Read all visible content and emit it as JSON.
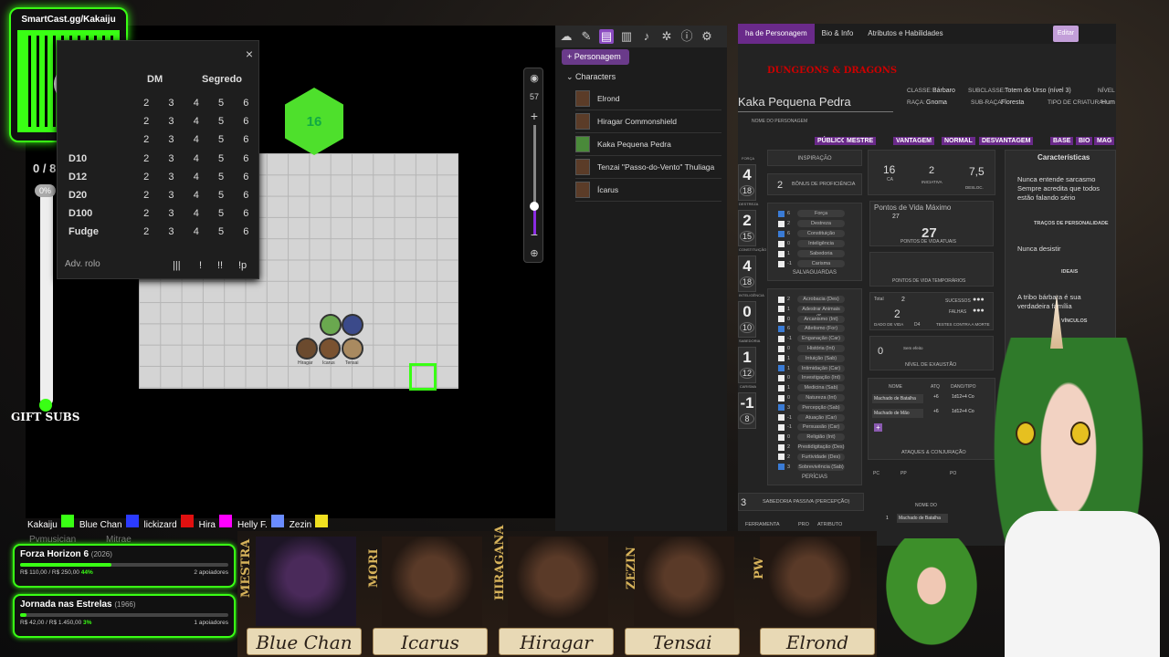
{
  "qr": {
    "title": "SmartCast.gg/Kakaiju"
  },
  "gift": {
    "count": "0 / 8",
    "pct": "0%",
    "label": "GIFT SUBS"
  },
  "dice": {
    "header_dm": "DM",
    "header_secret": "Segredo",
    "close": "×",
    "rows": [
      {
        "name": "",
        "vals": [
          "2",
          "3",
          "4",
          "5",
          "6"
        ]
      },
      {
        "name": "",
        "vals": [
          "2",
          "3",
          "4",
          "5",
          "6"
        ]
      },
      {
        "name": "",
        "vals": [
          "2",
          "3",
          "4",
          "5",
          "6"
        ]
      },
      {
        "name": "D10",
        "vals": [
          "2",
          "3",
          "4",
          "5",
          "6"
        ]
      },
      {
        "name": "D12",
        "vals": [
          "2",
          "3",
          "4",
          "5",
          "6"
        ]
      },
      {
        "name": "D20",
        "vals": [
          "2",
          "3",
          "4",
          "5",
          "6"
        ]
      },
      {
        "name": "D100",
        "vals": [
          "2",
          "3",
          "4",
          "5",
          "6"
        ]
      },
      {
        "name": "Fudge",
        "vals": [
          "2",
          "3",
          "4",
          "5",
          "6"
        ]
      }
    ],
    "adv": "Adv. rolo",
    "btn1": "|||",
    "btn2": "!",
    "btn3": "!!",
    "btn4": "!p"
  },
  "map": {
    "d20": "16",
    "tokens": [
      "Hiragar",
      "Icarus",
      "Tensai"
    ]
  },
  "zoom": {
    "eye": "◉",
    "value": "57",
    "plus": "+",
    "minus": "−",
    "target": "⊕"
  },
  "sidebar": {
    "add_label": "+ Personagem",
    "characters_label": "Characters",
    "characters": [
      "Elrond",
      "Hiragar Commonshield",
      "Kaka Pequena Pedra",
      "Tenzai \"Passo-do-Vento\" Thuliaga",
      "Ícarus"
    ]
  },
  "sheet": {
    "tabs": [
      "ha de Personagem",
      "Bio & Info",
      "Atributos e Habilidades"
    ],
    "edit": "Editar",
    "logo": "DUNGEONS & DRAGONS",
    "name": "Kaka Pequena Pedra",
    "name_label": "NOME DO PERSONAGEM",
    "class_l": "CLASSE:",
    "class_v": "Bárbaro",
    "subclass_l": "SUBCLASSE:",
    "subclass_v": "Totem do Urso (nível 3)",
    "level_l": "NÍVEL",
    "race_l": "RAÇA:",
    "race_v": "Gnoma",
    "subrace_l": "SUB-RAÇA:",
    "subrace_v": "Floresta",
    "type_l": "TIPO DE CRIATURA:",
    "type_v": "Hum",
    "pills": [
      "PÚBLICO",
      "MESTRE",
      "VANTAGEM",
      "NORMAL",
      "DESVANTAGEM",
      "BASE",
      "BIO",
      "MAG"
    ],
    "insp": "INSPIRAÇÃO",
    "prof_v": "2",
    "prof_l": "BÔNUS DE PROFICIÊNCIA",
    "stats": [
      {
        "s": "FORÇA",
        "v": "4",
        "m": "18"
      },
      {
        "s": "DESTREZA",
        "v": "2",
        "m": "15"
      },
      {
        "s": "CONSTITUIÇÃO",
        "v": "4",
        "m": "18"
      },
      {
        "s": "INTELIGÊNCIA",
        "v": "0",
        "m": "10"
      },
      {
        "s": "SABEDORIA",
        "v": "1",
        "m": "12"
      },
      {
        "s": "CARISMA",
        "v": "-1",
        "m": "8"
      }
    ],
    "saves": [
      {
        "v": "6",
        "n": "Força",
        "c": true
      },
      {
        "v": "2",
        "n": "Destreza",
        "c": false
      },
      {
        "v": "6",
        "n": "Constituição",
        "c": true
      },
      {
        "v": "0",
        "n": "Inteligência",
        "c": false
      },
      {
        "v": "1",
        "n": "Sabedoria",
        "c": false
      },
      {
        "v": "-1",
        "n": "Carisma",
        "c": false
      }
    ],
    "saves_l": "SALVAGUARDAS",
    "skills": [
      {
        "v": "2",
        "n": "Acrobacia (Des)",
        "c": false
      },
      {
        "v": "1",
        "n": "Adestrar Animais (S...",
        "c": false
      },
      {
        "v": "0",
        "n": "Arcanismo (Int)",
        "c": false
      },
      {
        "v": "6",
        "n": "Atletismo (For)",
        "c": true
      },
      {
        "v": "-1",
        "n": "Enganação (Car)",
        "c": false
      },
      {
        "v": "0",
        "n": "História (Int)",
        "c": false
      },
      {
        "v": "1",
        "n": "Intuição (Sab)",
        "c": false
      },
      {
        "v": "1",
        "n": "Intimidação (Car)",
        "c": true
      },
      {
        "v": "0",
        "n": "Investigação (Int)",
        "c": false
      },
      {
        "v": "1",
        "n": "Medicina (Sab)",
        "c": false
      },
      {
        "v": "0",
        "n": "Natureza (Int)",
        "c": false
      },
      {
        "v": "3",
        "n": "Percepção (Sab)",
        "c": true
      },
      {
        "v": "-1",
        "n": "Atuação (Car)",
        "c": false
      },
      {
        "v": "-1",
        "n": "Persuasão (Car)",
        "c": false
      },
      {
        "v": "0",
        "n": "Religião (Int)",
        "c": false
      },
      {
        "v": "2",
        "n": "Prestidigitação (Des)",
        "c": false
      },
      {
        "v": "2",
        "n": "Furtividade (Des)",
        "c": false
      },
      {
        "v": "3",
        "n": "Sobrevivência (Sab)",
        "c": true
      }
    ],
    "skills_l": "PERÍCIAS",
    "passive_v": "3",
    "passive_l": "SABEDORIA PASSIVA (PERCEPÇÃO)",
    "ca_v": "16",
    "ca_l": "CA",
    "init_v": "2",
    "init_l": "INICIATIVA",
    "speed_v": "7,5",
    "speed_l": "DESLOC.",
    "hpmax_l": "Pontos de Vida Máximo",
    "hpmax_v": "27",
    "hp_v": "27",
    "hp_l": "PONTOS DE VIDA ATUAIS",
    "thp_l": "PONTOS DE VIDA TEMPORÁRIOS",
    "hd_total_l": "Total",
    "hd_total_v": "2",
    "hd_v": "2",
    "hd_die": "D4",
    "hd_l": "DADO DE VIDA",
    "succ_l": "SUCESSOS",
    "fail_l": "FALHAS",
    "death_l": "TESTES CONTRA A MORTE",
    "exh_v": "0",
    "exh_note": "Sem efeito",
    "exh_l": "NÍVEL DE EXAUSTÃO",
    "atk_h": [
      "NOME",
      "ATQ",
      "DANO/TIPO"
    ],
    "attacks": [
      {
        "n": "Machado de Batalha",
        "a": "+6",
        "d": "1d12+4 Co"
      },
      {
        "n": "Machado de Mão",
        "a": "+6",
        "d": "1d12+4 Co"
      }
    ],
    "atk_l": "ATAQUES & CONJURAÇÃO",
    "coins": [
      "PC",
      "PP",
      "PO"
    ],
    "eq_h": "NOME DO",
    "eq_row": "Machado de Batalha",
    "eq_n": "1",
    "tools_l": [
      "FERRAMENTA",
      "PRO",
      "ATRIBUTO"
    ],
    "feat_h": "Características",
    "traits": "Nunca entende sarcasmo Sempre acredita que todos estão falando sério",
    "traits_l": "TRAÇOS DE PERSONALIDADE",
    "ideals": "Nunca desistir",
    "ideals_l": "IDEAIS",
    "bonds": "A tribo bárbara é sua verdadeira família",
    "bonds_l": "VÍNCULOS"
  },
  "chat": {
    "users": [
      {
        "n": "Kakaiju",
        "c": "#39ff14"
      },
      {
        "n": "Blue Chan",
        "c": "#2b3bff"
      },
      {
        "n": "lickizard",
        "c": "#e01010"
      },
      {
        "n": "Hira",
        "c": "#ff00ff"
      },
      {
        "n": "Helly F.",
        "c": "#6a8cff"
      },
      {
        "n": "Zezin",
        "c": "#f0e020"
      }
    ],
    "extra": "Pvmusician",
    "extra2": "Mitrae"
  },
  "goals": [
    {
      "t": "Forza Horizon 6",
      "y": "(2026)",
      "amt": "R$ 110,00 / R$ 250,00",
      "pct": "44%",
      "pct_v": 0.44,
      "sup": "2 apoiadores"
    },
    {
      "t": "Jornada nas Estrelas",
      "y": "(1966)",
      "amt": "R$ 42,00 / R$ 1.450,00",
      "pct": "3%",
      "pct_v": 0.03,
      "sup": "1 apoiadores"
    }
  ],
  "cams": {
    "tags": [
      "MESTRA",
      "MORI",
      "HIRAGANA",
      "ZEZIN",
      "PW"
    ],
    "names": [
      "Blue Chan",
      "Icarus",
      "Hiragar",
      "Tensai",
      "Elrond"
    ]
  }
}
